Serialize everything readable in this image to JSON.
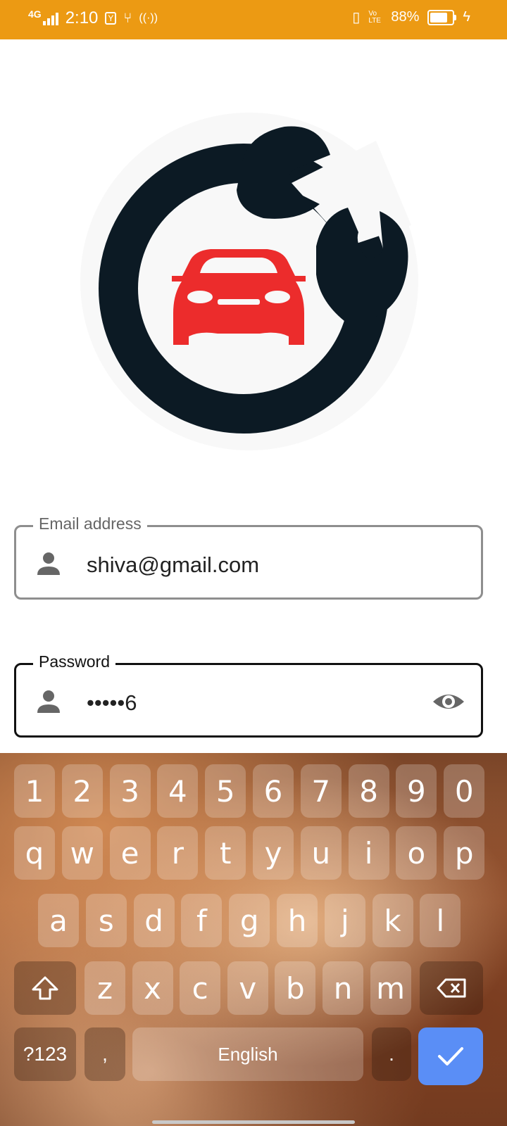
{
  "status_bar": {
    "network": "4G",
    "time": "2:10",
    "battery": "88%",
    "volte": "Vo LTE",
    "color": "#ec9a13"
  },
  "logo": {
    "icon": "car-wrench-logo-icon",
    "colors": {
      "ring": "#0c1a24",
      "car": "#ec2c2c"
    }
  },
  "email_field": {
    "label": "Email address",
    "value": "shiva@gmail.com",
    "icon": "person-icon"
  },
  "password_field": {
    "label": "Password",
    "value": "•••••6",
    "icon": "person-icon",
    "toggle_icon": "eye-icon"
  },
  "keyboard": {
    "rows": [
      [
        "1",
        "2",
        "3",
        "4",
        "5",
        "6",
        "7",
        "8",
        "9",
        "0"
      ],
      [
        "q",
        "w",
        "e",
        "r",
        "t",
        "y",
        "u",
        "i",
        "o",
        "p"
      ],
      [
        "a",
        "s",
        "d",
        "f",
        "g",
        "h",
        "j",
        "k",
        "l"
      ],
      [
        "z",
        "x",
        "c",
        "v",
        "b",
        "n",
        "m"
      ]
    ],
    "symbols_label": "?123",
    "comma_label": ",",
    "space_label": "English",
    "period_label": ".",
    "accent": "#5a8ef6"
  }
}
